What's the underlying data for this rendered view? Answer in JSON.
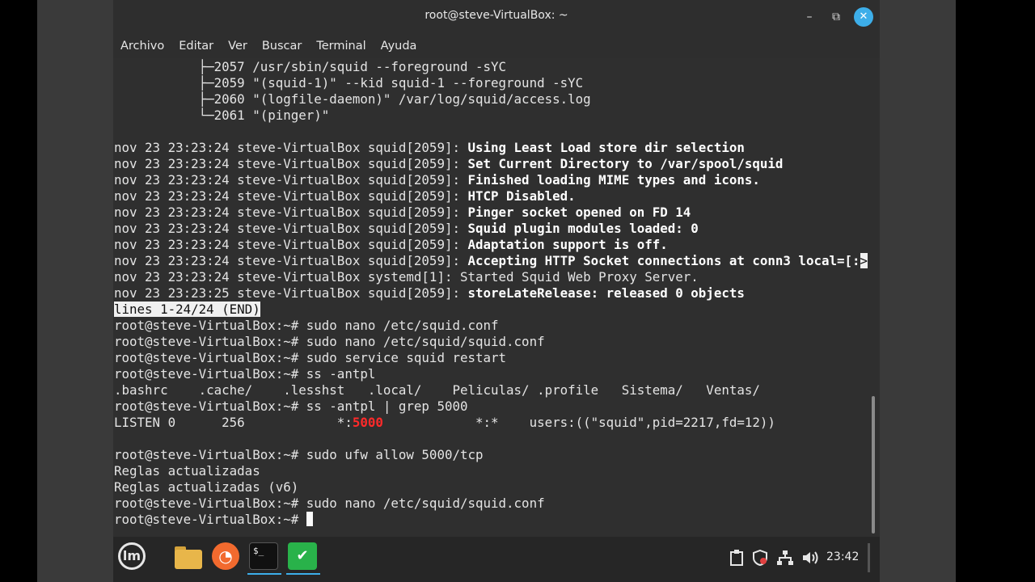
{
  "window": {
    "title": "root@steve-VirtualBox: ~",
    "controls": {
      "minimize": "–",
      "maximize": "⧉",
      "close": "✕"
    }
  },
  "menu": [
    "Archivo",
    "Editar",
    "Ver",
    "Buscar",
    "Terminal",
    "Ayuda"
  ],
  "terminal": {
    "tree": [
      "           ├─2057 /usr/sbin/squid --foreground -sYC",
      "           ├─2059 \"(squid-1)\" --kid squid-1 --foreground -sYC",
      "           ├─2060 \"(logfile-daemon)\" /var/log/squid/access.log",
      "           └─2061 \"(pinger)\""
    ],
    "log_prefix": "nov 23 23:23:24 steve-VirtualBox squid[2059]: ",
    "log_messages": [
      "Using Least Load store dir selection",
      "Set Current Directory to /var/spool/squid",
      "Finished loading MIME types and icons.",
      "HTCP Disabled.",
      "Pinger socket opened on FD 14",
      "Squid plugin modules loaded: 0",
      "Adaptation support is off.",
      "Accepting HTTP Socket connections at conn3 local=[:"
    ],
    "overflow_marker": ">",
    "systemd_line": "nov 23 23:23:24 steve-VirtualBox systemd[1]: Started Squid Web Proxy Server.",
    "last_log_prefix": "nov 23 23:23:25 steve-VirtualBox squid[2059]: ",
    "last_log_message": "storeLateRelease: released 0 objects",
    "pager_status": "lines 1-24/24 (END)",
    "prompt": "root@steve-VirtualBox:~# ",
    "cmd1": "sudo nano /etc/squid.conf",
    "cmd2": "sudo nano /etc/squid/squid.conf",
    "cmd3": "sudo service squid restart",
    "cmd4": "ss -antpl",
    "completions": ".bashrc    .cache/    .lesshst   .local/    Peliculas/ .profile   Sistema/   Ventas/",
    "cmd5": "ss -antpl | grep 5000",
    "listen_a": "LISTEN 0      256            *:",
    "listen_port": "5000",
    "listen_b": "            *:*    users:((\"squid\",pid=2217,fd=12))",
    "cmd6": "sudo ufw allow 5000/tcp",
    "out1": "Reglas actualizadas",
    "out2": "Reglas actualizadas (v6)",
    "cmd7": "sudo nano /etc/squid/squid.conf"
  },
  "taskbar": {
    "menu_logo": "lm",
    "terminal_glyph": "$_",
    "firefox_glyph": "◔",
    "shield_glyph": "✔",
    "tray_icons": [
      "clipboard-icon",
      "security-shield-icon",
      "network-icon",
      "volume-icon"
    ],
    "clock": "23:42"
  },
  "colors": {
    "accent": "#3daee9",
    "terminal_bg": "#2f2f2f",
    "highlight_red": "#ff2a2a"
  }
}
